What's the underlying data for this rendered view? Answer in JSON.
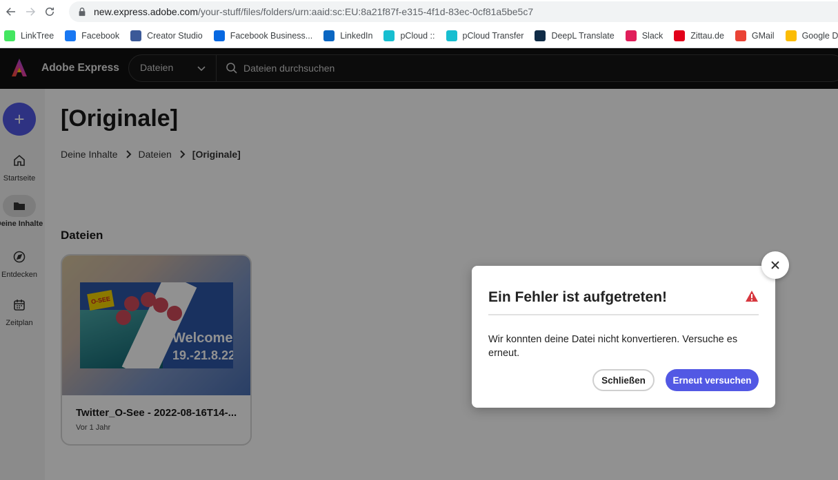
{
  "browser": {
    "url_host": "new.express.adobe.com",
    "url_path": "/your-stuff/files/folders/urn:aaid:sc:EU:8a21f87f-e315-4f1d-83ec-0cf81a5be5c7",
    "bookmarks": [
      {
        "label": "LinkTree",
        "icon": "linktree-icon",
        "color": "#43e660"
      },
      {
        "label": "Facebook",
        "icon": "facebook-icon",
        "color": "#1877f2"
      },
      {
        "label": "Creator Studio",
        "icon": "creator-studio-icon",
        "color": "#3b5998"
      },
      {
        "label": "Facebook Business...",
        "icon": "meta-icon",
        "color": "#0668e1"
      },
      {
        "label": "LinkedIn",
        "icon": "linkedin-icon",
        "color": "#0a66c2"
      },
      {
        "label": "pCloud ::",
        "icon": "pcloud-icon",
        "color": "#17bed0"
      },
      {
        "label": "pCloud Transfer",
        "icon": "pcloud-icon",
        "color": "#17bed0"
      },
      {
        "label": "DeepL Translate",
        "icon": "deepl-icon",
        "color": "#0f2b46"
      },
      {
        "label": "Slack",
        "icon": "slack-icon",
        "color": "#e01e5a"
      },
      {
        "label": "Zittau.de",
        "icon": "zittau-icon",
        "color": "#e2001a"
      },
      {
        "label": "GMail",
        "icon": "gmail-icon",
        "color": "#ea4335"
      },
      {
        "label": "Google Drive",
        "icon": "google-drive-icon",
        "color": "#fbbc04"
      }
    ]
  },
  "app": {
    "name": "Adobe Express",
    "scope_label": "Dateien",
    "search_placeholder": "Dateien durchsuchen"
  },
  "sidebar": {
    "items": [
      {
        "label": "Startseite",
        "icon": "home-icon",
        "active": false
      },
      {
        "label": "Deine Inhalte",
        "icon": "folder-icon",
        "active": true
      },
      {
        "label": "Entdecken",
        "icon": "discover-icon",
        "active": false
      },
      {
        "label": "Zeitplan",
        "icon": "calendar-icon",
        "active": false
      }
    ]
  },
  "main": {
    "title": "[Originale]",
    "breadcrumb": [
      "Deine Inhalte",
      "Dateien",
      "[Originale]"
    ],
    "section_title": "Dateien",
    "file": {
      "name": "Twitter_O-See - 2022-08-16T14-...",
      "date": "Vor 1 Jahr",
      "thumb_logo": "O-SEE",
      "thumb_welcome": "Welcome!",
      "thumb_date": "19.-21.8.22"
    }
  },
  "dialog": {
    "title": "Ein Fehler ist aufgetreten!",
    "message": "Wir konnten deine Datei nicht konvertieren. Versuche es erneut.",
    "close_label": "Schließen",
    "retry_label": "Erneut versuchen",
    "accent": "#5258e4",
    "warning_color": "#d7373f"
  }
}
